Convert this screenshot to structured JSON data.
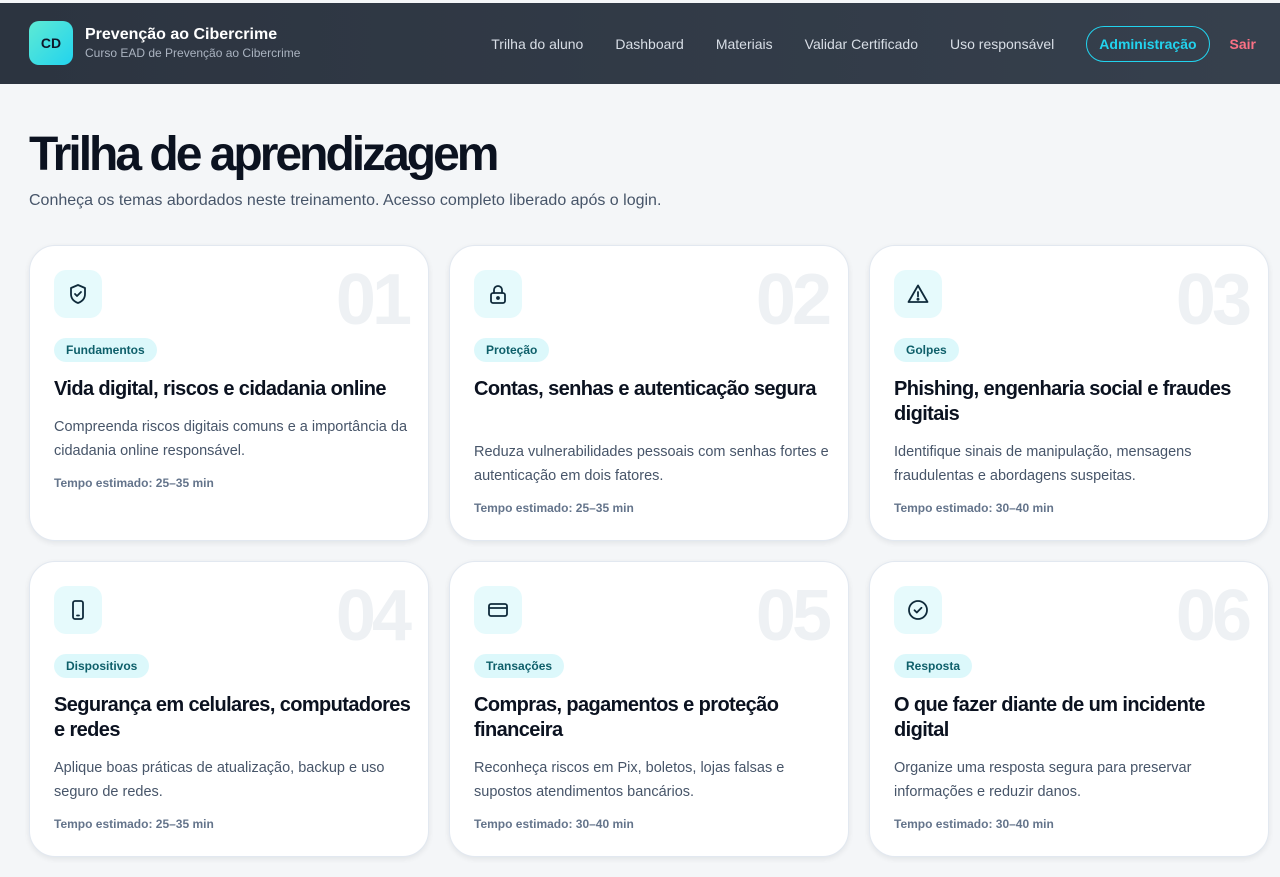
{
  "header": {
    "logo_text": "CD",
    "title": "Prevenção ao Cibercrime",
    "subtitle": "Curso EAD de Prevenção ao Cibercrime",
    "nav": [
      "Trilha do aluno",
      "Dashboard",
      "Materiais",
      "Validar Certificado",
      "Uso responsável"
    ],
    "admin_label": "Administração",
    "logout_label": "Sair"
  },
  "page": {
    "title": "Trilha de aprendizagem",
    "subtitle": "Conheça os temas abordados neste treinamento. Acesso completo liberado após o login."
  },
  "modules": [
    {
      "number": "01",
      "icon": "shield-check-icon",
      "tag": "Fundamentos",
      "title": "Vida digital, riscos e cidadania online",
      "description": "Compreenda riscos digitais comuns e a importância da cidadania online responsável.",
      "time": "Tempo estimado: 25–35 min"
    },
    {
      "number": "02",
      "icon": "lock-icon",
      "tag": "Proteção",
      "title": "Contas, senhas e autenticação segura",
      "description": "Reduza vulnerabilidades pessoais com senhas fortes e autenticação em dois fatores.",
      "time": "Tempo estimado: 25–35 min"
    },
    {
      "number": "03",
      "icon": "warning-triangle-icon",
      "tag": "Golpes",
      "title": "Phishing, engenharia social e fraudes digitais",
      "description": "Identifique sinais de manipulação, mensagens fraudulentas e abordagens suspeitas.",
      "time": "Tempo estimado: 30–40 min"
    },
    {
      "number": "04",
      "icon": "smartphone-icon",
      "tag": "Dispositivos",
      "title": "Segurança em celulares, computadores e redes",
      "description": "Aplique boas práticas de atualização, backup e uso seguro de redes.",
      "time": "Tempo estimado: 25–35 min"
    },
    {
      "number": "05",
      "icon": "credit-card-icon",
      "tag": "Transações",
      "title": "Compras, pagamentos e proteção financeira",
      "description": "Reconheça riscos em Pix, boletos, lojas falsas e supostos atendimentos bancários.",
      "time": "Tempo estimado: 30–40 min"
    },
    {
      "number": "06",
      "icon": "check-circle-icon",
      "tag": "Resposta",
      "title": "O que fazer diante de um incidente digital",
      "description": "Organize uma resposta segura para preservar informações e reduzir danos.",
      "time": "Tempo estimado: 30–40 min"
    }
  ],
  "colors": {
    "header_bg": "#2c3440",
    "accent": "#22d3ee",
    "logout": "#fb7185",
    "tag_bg": "#dcf8fb",
    "tag_text": "#0e5f6a"
  }
}
